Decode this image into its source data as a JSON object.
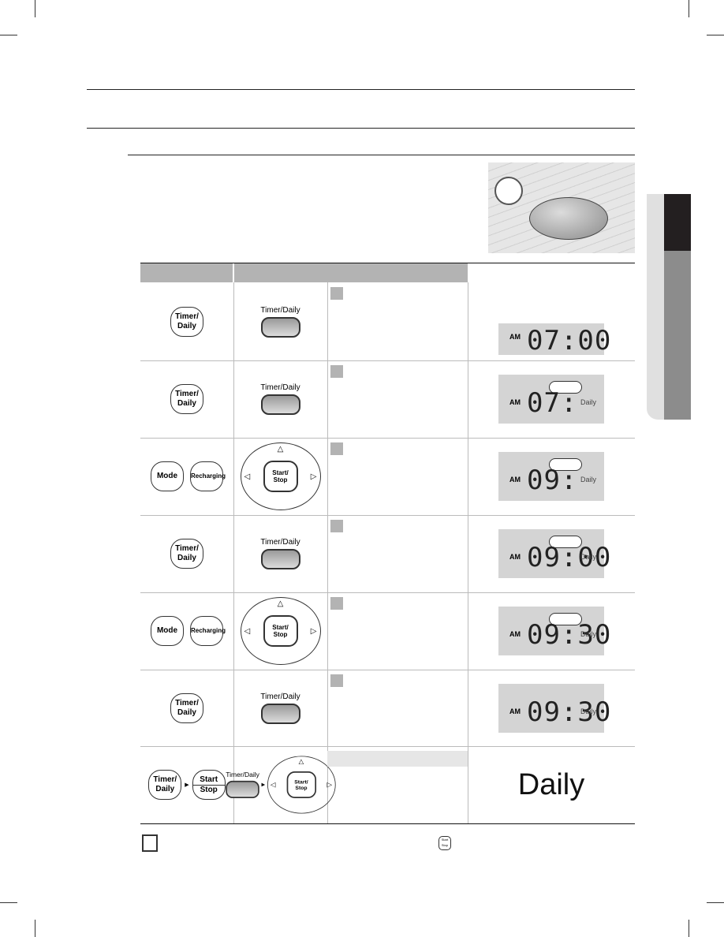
{
  "buttons": {
    "timer_daily": "Timer/ Daily",
    "timer_daily_panel": "Timer/Daily",
    "mode": "Mode",
    "recharging": "Recharging",
    "start_stop": "Start/ Stop",
    "start": "Start",
    "stop": "Stop"
  },
  "display": {
    "am": "AM",
    "daily": "Daily"
  },
  "rows": [
    {
      "digits": "07:00",
      "bubble": false,
      "daily": false
    },
    {
      "digits": "07:",
      "bubble": true,
      "daily": true
    },
    {
      "digits": "09:",
      "bubble": true,
      "daily": true
    },
    {
      "digits": "09:00",
      "bubble": true,
      "daily": true
    },
    {
      "digits": "09:30",
      "bubble": true,
      "daily": true
    },
    {
      "digits": "09:30",
      "bubble": false,
      "daily": true
    }
  ],
  "final_display": "Daily",
  "colors": {
    "header_gray": "#b3b3b3",
    "lcd": "#d4d4d4",
    "tab_dark": "#231f20"
  }
}
